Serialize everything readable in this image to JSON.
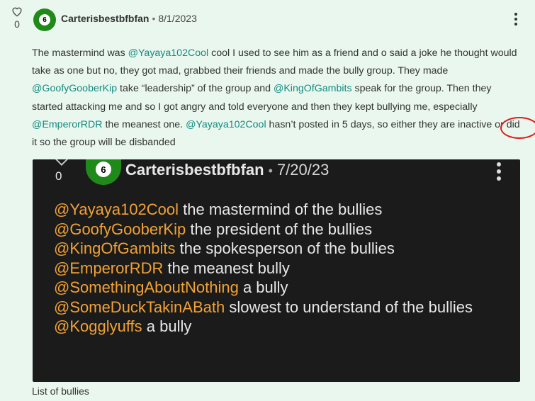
{
  "post": {
    "vote_count": "0",
    "avatar_number": "6",
    "username": "Carterisbestbfbfan",
    "separator": "•",
    "date": "8/1/2023",
    "body": {
      "t1": "The mastermind was ",
      "m1": "@Yayaya102Cool",
      "t2": "  cool I used to see him as a friend and o said a joke he thought would take as one but no, they got mad, grabbed their friends and made the bully group. They made ",
      "m2": "@GoofyGooberKip",
      "t3": "  take “leadership” of the group and ",
      "m3": "@KingOfGambits",
      "t4": " speak for the group. Then they started attacking me and so I got angry and told everyone and then they kept bullying me, especially ",
      "m4": "@EmperorRDR",
      "t5": " the meanest one. ",
      "m5": "@Yayaya102Cool",
      "t6": "  hasn’t posted in 5 days, so either they are inactive o",
      "t7": "r ",
      "circled": "did it",
      "t8": " so the group will be disbanded"
    }
  },
  "screenshot": {
    "vote_count": "0",
    "avatar_number": "6",
    "username": "Carterisbestbfbfan",
    "separator": "•",
    "date": "7/20/23",
    "lines": [
      {
        "mention": "@Yayaya102Cool",
        "text": " the mastermind of the bullies"
      },
      {
        "mention": "@GoofyGooberKip",
        "text": " the president of the bullies"
      },
      {
        "mention": "@KingOfGambits",
        "text": " the spokesperson of the bullies"
      },
      {
        "mention": "@EmperorRDR",
        "text": " the meanest bully"
      },
      {
        "mention": "@SomethingAboutNothing",
        "text": " a bully"
      },
      {
        "mention": "@SomeDuckTakinABath",
        "text": " slowest to understand of the bullies"
      },
      {
        "mention": "@Kogglyuffs",
        "text": " a bully"
      }
    ]
  },
  "caption": "List of bullies",
  "colors": {
    "background": "#eaf7ee",
    "mention": "#138a7f",
    "screenshot_mention": "#f2a235",
    "annotation_circle": "#e21b1b",
    "avatar": "#1f8a1a"
  }
}
